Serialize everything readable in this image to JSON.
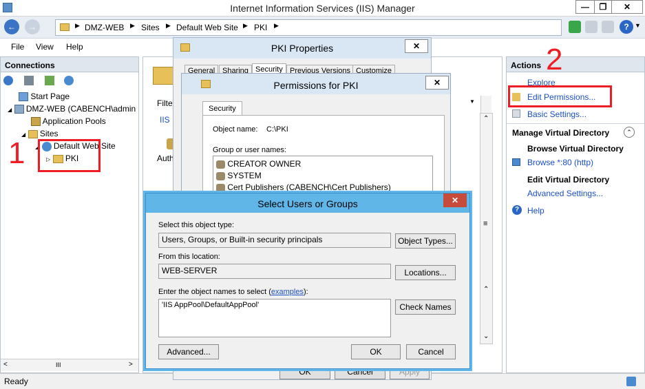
{
  "window": {
    "title": "Internet Information Services (IIS) Manager"
  },
  "address": {
    "crumbs": [
      "DMZ-WEB",
      "Sites",
      "Default Web Site",
      "PKI"
    ]
  },
  "menu": [
    "File",
    "View",
    "Help"
  ],
  "connections": {
    "title": "Connections",
    "tree": [
      "Start Page",
      "DMZ-WEB (CABENCH\\admin",
      "Application Pools",
      "Sites",
      "Default Web Site",
      "PKI"
    ]
  },
  "center": {
    "filter_label": "Filte",
    "iis_label": "IIS",
    "auth_label": "Auth"
  },
  "annotations": {
    "one": "1",
    "two": "2"
  },
  "actions": {
    "title": "Actions",
    "explore": "Explore",
    "edit_permissions": "Edit Permissions...",
    "basic_settings": "Basic Settings...",
    "manage_title": "Manage Virtual Directory",
    "browse_title": "Browse Virtual Directory",
    "browse_link": "Browse *:80 (http)",
    "edit_title": "Edit Virtual Directory",
    "advanced_link": "Advanced Settings...",
    "help": "Help"
  },
  "pki_props": {
    "title": "PKI Properties",
    "tabs": [
      "General",
      "Sharing",
      "Security",
      "Previous Versions",
      "Customize"
    ],
    "buttons": {
      "ok": "OK",
      "cancel": "Cancel",
      "apply": "Apply"
    }
  },
  "perms": {
    "title": "Permissions for PKI",
    "tab": "Security",
    "object_label": "Object name:",
    "object_value": "C:\\PKI",
    "group_label": "Group or user names:",
    "users": [
      "CREATOR OWNER",
      "SYSTEM",
      "Cert Publishers (CABENCH\\Cert Publishers)"
    ]
  },
  "select": {
    "title": "Select Users or Groups",
    "type_label": "Select this object type:",
    "type_value": "Users, Groups, or Built-in security principals",
    "object_types_btn": "Object Types...",
    "location_label": "From this location:",
    "location_value": "WEB-SERVER",
    "locations_btn": "Locations...",
    "names_label_pre": "Enter the object names to select (",
    "names_label_link": "examples",
    "names_label_post": "):",
    "names_value": "'IIS AppPool\\DefaultAppPool'",
    "check_names_btn": "Check Names",
    "advanced_btn": "Advanced...",
    "ok_btn": "OK",
    "cancel_btn": "Cancel"
  },
  "status": {
    "text": "Ready"
  }
}
